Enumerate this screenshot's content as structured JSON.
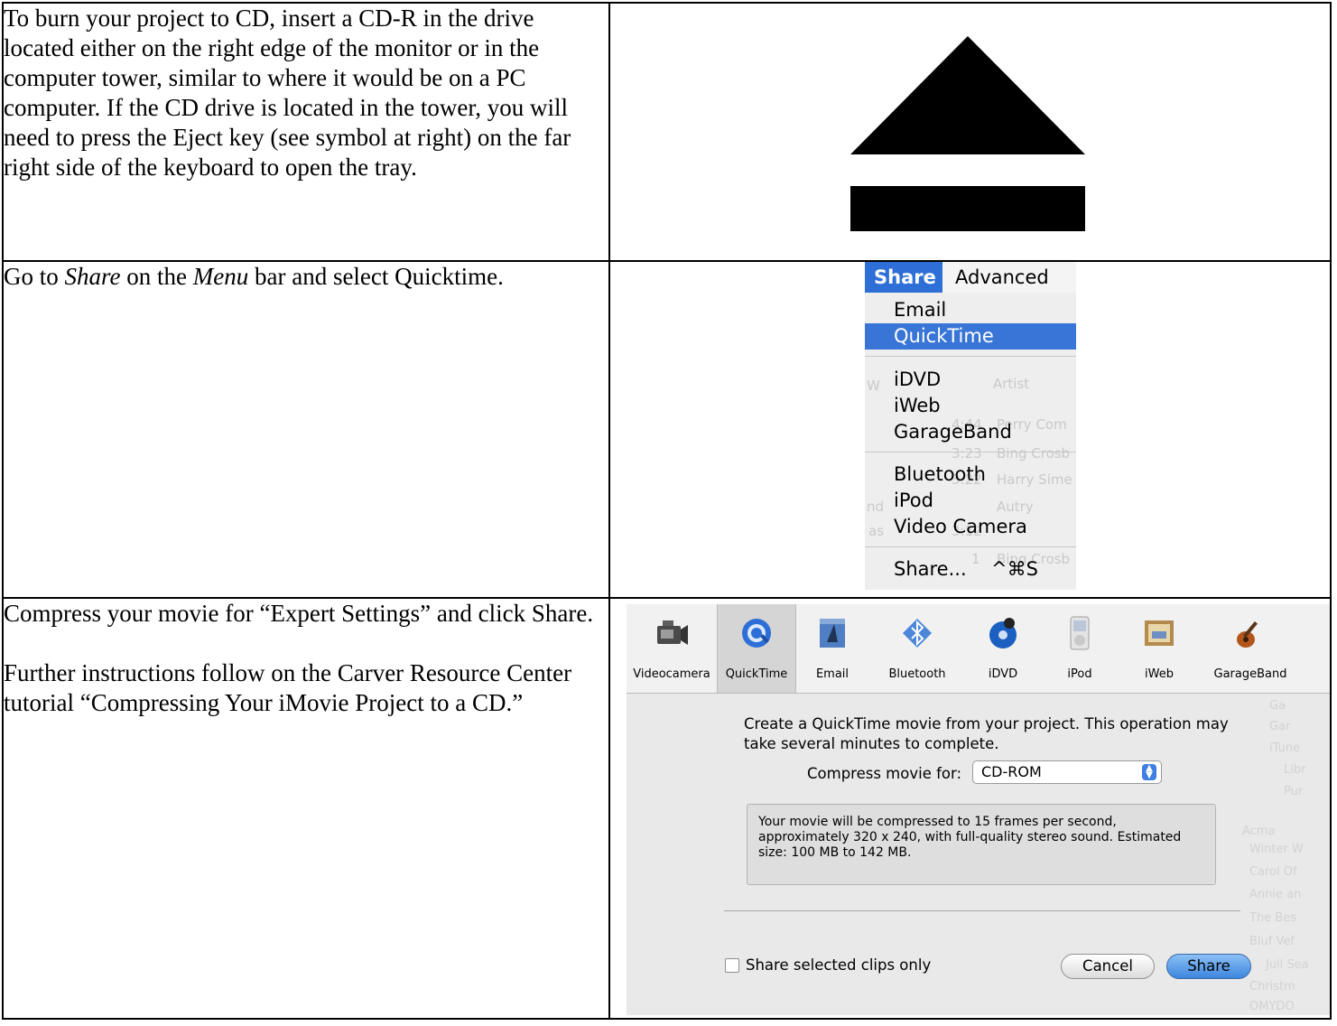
{
  "rows": [
    {
      "text": "To burn your project to CD, insert a CD-R in the drive located either on the right edge of the monitor or in the computer tower, similar to where it would be on a PC computer.  If the CD drive is located in the tower, you will need to press the Eject key (see symbol at right) on the far right side of the keyboard to open the tray."
    },
    {
      "text_pre": "Go to ",
      "text_share": "Share",
      "text_mid": " on the ",
      "text_menu": "Menu",
      "text_post": " bar and select Quicktime."
    },
    {
      "para1": "Compress your movie for “Expert Settings” and click Share.",
      "para2": "Further instructions follow on the Carver Resource Center tutorial “Compressing Your iMovie Project to a CD.”"
    }
  ],
  "eject_icon": "eject-icon",
  "menu": {
    "title_share": "Share",
    "title_advanced": "Advanced",
    "items": [
      "Email",
      "QuickTime",
      "iDVD",
      "iWeb",
      "GarageBand",
      "Bluetooth",
      "iPod",
      "Video Camera",
      "Share..."
    ],
    "selected": "QuickTime",
    "share_shortcut": "^⌘S",
    "highlight_color": "#3875d7",
    "background_ghost": [
      "Artist",
      "W",
      "4:44",
      "Perry Com",
      "3:23",
      "Bing Crosb",
      "3:22",
      "Harry Sime",
      "nd",
      "Autry",
      "as",
      "3:12",
      "1",
      "Bing Crosb"
    ]
  },
  "dialog": {
    "tools": [
      {
        "label": "Videocamera",
        "icon": "videocamera-icon"
      },
      {
        "label": "QuickTime",
        "icon": "quicktime-icon"
      },
      {
        "label": "Email",
        "icon": "email-icon"
      },
      {
        "label": "Bluetooth",
        "icon": "bluetooth-icon"
      },
      {
        "label": "iDVD",
        "icon": "idvd-icon"
      },
      {
        "label": "iPod",
        "icon": "ipod-icon"
      },
      {
        "label": "iWeb",
        "icon": "iweb-icon"
      },
      {
        "label": "GarageBand",
        "icon": "garageband-icon"
      }
    ],
    "selected_tool": "QuickTime",
    "description": "Create a QuickTime movie from your project. This operation may take several minutes to complete.",
    "compress_label": "Compress movie for:",
    "compress_value": "CD-ROM",
    "info": "Your movie will be compressed to 15 frames per second, approximately 320 x 240, with full-quality stereo sound. Estimated size: 100 MB to 142 MB.",
    "checkbox_label": "Share selected clips only",
    "checkbox_checked": false,
    "cancel_label": "Cancel",
    "share_label": "Share",
    "background_ghost": [
      "Ga",
      "Gar",
      "iTune",
      "Libr",
      "Pur",
      "Acma",
      "Winter W",
      "Carol Of",
      "Annie an",
      "The Bes",
      "Bluf Vef",
      "Jull Sea",
      "Christm",
      "OMYDO"
    ]
  }
}
